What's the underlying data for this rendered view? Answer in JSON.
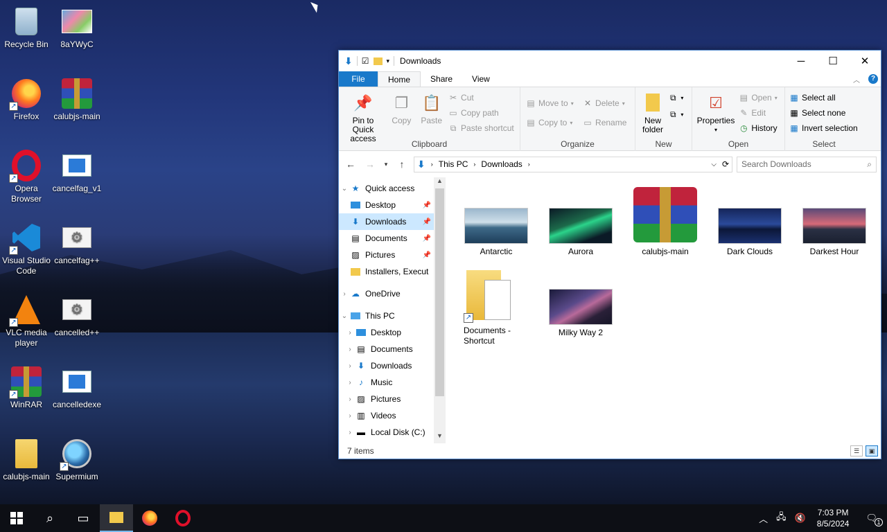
{
  "desktop": {
    "icons": [
      {
        "label": "Recycle Bin"
      },
      {
        "label": "8aYWyC"
      },
      {
        "label": "Firefox"
      },
      {
        "label": "calubjs-main"
      },
      {
        "label": "Opera Browser"
      },
      {
        "label": "cancelfag_v1"
      },
      {
        "label": "Visual Studio Code"
      },
      {
        "label": "cancelfag++"
      },
      {
        "label": "VLC media player"
      },
      {
        "label": "cancelled++"
      },
      {
        "label": "WinRAR"
      },
      {
        "label": "cancelledexe"
      },
      {
        "label": "calubjs-main"
      },
      {
        "label": "Supermium"
      }
    ]
  },
  "explorer": {
    "title": "Downloads",
    "tabs": {
      "file": "File",
      "home": "Home",
      "share": "Share",
      "view": "View"
    },
    "ribbon": {
      "clipboard": {
        "label": "Clipboard",
        "pin": "Pin to Quick access",
        "copy": "Copy",
        "paste": "Paste",
        "cut": "Cut",
        "copy_path": "Copy path",
        "paste_shortcut": "Paste shortcut"
      },
      "organize": {
        "label": "Organize",
        "move_to": "Move to",
        "copy_to": "Copy to",
        "delete": "Delete",
        "rename": "Rename"
      },
      "new": {
        "label": "New",
        "new_folder": "New folder"
      },
      "open": {
        "label": "Open",
        "properties": "Properties",
        "open": "Open",
        "edit": "Edit",
        "history": "History"
      },
      "select": {
        "label": "Select",
        "select_all": "Select all",
        "select_none": "Select none",
        "invert": "Invert selection"
      }
    },
    "address": {
      "crumbs": [
        "This PC",
        "Downloads"
      ],
      "search_placeholder": "Search Downloads"
    },
    "tree": [
      {
        "label": "Quick access"
      },
      {
        "label": "Desktop"
      },
      {
        "label": "Downloads"
      },
      {
        "label": "Documents"
      },
      {
        "label": "Pictures"
      },
      {
        "label": "Installers, Execut"
      },
      {
        "label": "OneDrive"
      },
      {
        "label": "This PC"
      },
      {
        "label": "Desktop"
      },
      {
        "label": "Documents"
      },
      {
        "label": "Downloads"
      },
      {
        "label": "Music"
      },
      {
        "label": "Pictures"
      },
      {
        "label": "Videos"
      },
      {
        "label": "Local Disk (C:)"
      }
    ],
    "files": [
      {
        "name": "Antarctic"
      },
      {
        "name": "Aurora"
      },
      {
        "name": "calubjs-main"
      },
      {
        "name": "Dark Clouds"
      },
      {
        "name": "Darkest Hour"
      },
      {
        "name": "Documents - Shortcut"
      },
      {
        "name": "Milky Way 2"
      }
    ],
    "status": "7 items"
  },
  "taskbar": {
    "time": "7:03 PM",
    "date": "8/5/2024",
    "notification_count": "1"
  }
}
